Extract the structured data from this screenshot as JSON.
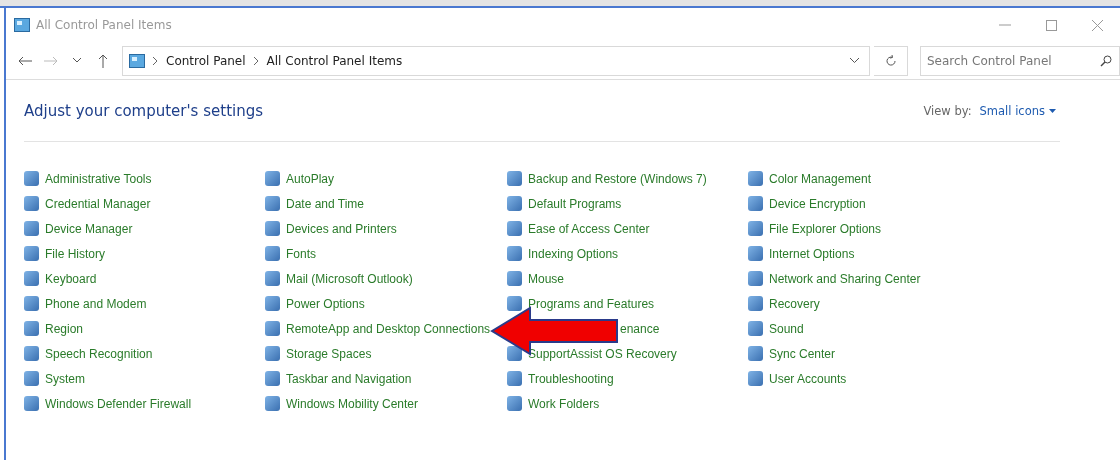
{
  "window": {
    "title": "All Control Panel Items"
  },
  "address_bar": {
    "breadcrumbs": [
      "Control Panel",
      "All Control Panel Items"
    ]
  },
  "search": {
    "placeholder": "Search Control Panel"
  },
  "header": {
    "title": "Adjust your computer's settings",
    "view_by_label": "View by:",
    "view_by_value": "Small icons"
  },
  "columns": [
    [
      {
        "label": "Administrative Tools"
      },
      {
        "label": "Credential Manager"
      },
      {
        "label": "Device Manager"
      },
      {
        "label": "File History"
      },
      {
        "label": "Keyboard"
      },
      {
        "label": "Phone and Modem"
      },
      {
        "label": "Region"
      },
      {
        "label": "Speech Recognition"
      },
      {
        "label": "System"
      },
      {
        "label": "Windows Defender Firewall"
      }
    ],
    [
      {
        "label": "AutoPlay"
      },
      {
        "label": "Date and Time"
      },
      {
        "label": "Devices and Printers"
      },
      {
        "label": "Fonts"
      },
      {
        "label": "Mail (Microsoft Outlook)"
      },
      {
        "label": "Power Options"
      },
      {
        "label": "RemoteApp and Desktop Connections"
      },
      {
        "label": "Storage Spaces"
      },
      {
        "label": "Taskbar and Navigation"
      },
      {
        "label": "Windows Mobility Center"
      }
    ],
    [
      {
        "label": "Backup and Restore (Windows 7)"
      },
      {
        "label": "Default Programs"
      },
      {
        "label": "Ease of Access Center"
      },
      {
        "label": "Indexing Options"
      },
      {
        "label": "Mouse"
      },
      {
        "label": "Programs and Features"
      },
      {
        "label": "enance",
        "covered": true
      },
      {
        "label": "SupportAssist OS Recovery"
      },
      {
        "label": "Troubleshooting"
      },
      {
        "label": "Work Folders"
      }
    ],
    [
      {
        "label": "Color Management"
      },
      {
        "label": "Device Encryption"
      },
      {
        "label": "File Explorer Options"
      },
      {
        "label": "Internet Options"
      },
      {
        "label": "Network and Sharing Center"
      },
      {
        "label": "Recovery"
      },
      {
        "label": "Sound"
      },
      {
        "label": "Sync Center"
      },
      {
        "label": "User Accounts"
      }
    ]
  ]
}
